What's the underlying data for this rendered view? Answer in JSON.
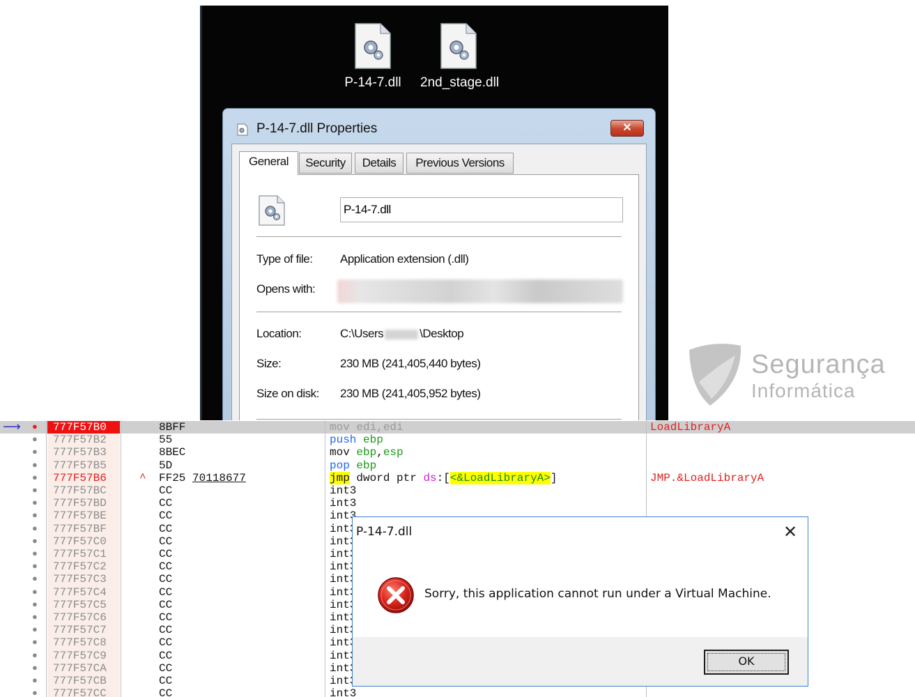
{
  "desktop": {
    "icons": [
      {
        "label": "P-14-7.dll"
      },
      {
        "label": "2nd_stage.dll"
      }
    ]
  },
  "properties": {
    "title": "P-14-7.dll Properties",
    "close_label": "✕",
    "tabs": [
      "General",
      "Security",
      "Details",
      "Previous Versions"
    ],
    "filename": "P-14-7.dll",
    "type_label": "Type of file:",
    "type_value": "Application extension (.dll)",
    "opens_label": "Opens with:",
    "location_label": "Location:",
    "location_prefix": "C:\\Users",
    "location_suffix": "\\Desktop",
    "size_label": "Size:",
    "size_value": "230 MB (241,405,440 bytes)",
    "disk_label": "Size on disk:",
    "disk_value": "230 MB (241,405,952 bytes)"
  },
  "watermark": {
    "line1": "Segurança",
    "line2": "Informática"
  },
  "debugger": {
    "rows": [
      {
        "addr": "777F57B0",
        "bytes": "8BFF",
        "dis": "mov edi,edi",
        "comment": "LoadLibraryA"
      },
      {
        "addr": "777F57B2",
        "bytes": "55",
        "dis": "push ebp",
        "comment": ""
      },
      {
        "addr": "777F57B3",
        "bytes": "8BEC",
        "dis": "mov ebp,esp",
        "comment": ""
      },
      {
        "addr": "777F57B5",
        "bytes": "5D",
        "dis": "pop ebp",
        "comment": ""
      },
      {
        "addr": "777F57B6",
        "bytes": "FF25 70118677",
        "dis": "jmp dword ptr ds:[<&LoadLibraryA>]",
        "comment": "JMP.&LoadLibraryA"
      },
      {
        "addr": "777F57BC",
        "bytes": "CC",
        "dis": "int3",
        "comment": ""
      },
      {
        "addr": "777F57BD",
        "bytes": "CC",
        "dis": "int3",
        "comment": ""
      },
      {
        "addr": "777F57BE",
        "bytes": "CC",
        "dis": "int3",
        "comment": ""
      },
      {
        "addr": "777F57BF",
        "bytes": "CC",
        "dis": "int3",
        "comment": ""
      },
      {
        "addr": "777F57C0",
        "bytes": "CC",
        "dis": "int3",
        "comment": ""
      },
      {
        "addr": "777F57C1",
        "bytes": "CC",
        "dis": "int3",
        "comment": ""
      },
      {
        "addr": "777F57C2",
        "bytes": "CC",
        "dis": "int3",
        "comment": ""
      },
      {
        "addr": "777F57C3",
        "bytes": "CC",
        "dis": "int3",
        "comment": ""
      },
      {
        "addr": "777F57C4",
        "bytes": "CC",
        "dis": "int3",
        "comment": ""
      },
      {
        "addr": "777F57C5",
        "bytes": "CC",
        "dis": "int3",
        "comment": ""
      },
      {
        "addr": "777F57C6",
        "bytes": "CC",
        "dis": "int3",
        "comment": ""
      },
      {
        "addr": "777F57C7",
        "bytes": "CC",
        "dis": "int3",
        "comment": ""
      },
      {
        "addr": "777F57C8",
        "bytes": "CC",
        "dis": "int3",
        "comment": ""
      },
      {
        "addr": "777F57C9",
        "bytes": "CC",
        "dis": "int3",
        "comment": ""
      },
      {
        "addr": "777F57CA",
        "bytes": "CC",
        "dis": "int3",
        "comment": ""
      },
      {
        "addr": "777F57CB",
        "bytes": "CC",
        "dis": "int3",
        "comment": ""
      },
      {
        "addr": "777F57CC",
        "bytes": "CC",
        "dis": "int3",
        "comment": ""
      }
    ]
  },
  "msgbox": {
    "title": "P-14-7.dll",
    "close_label": "✕",
    "message": "Sorry, this application cannot run under a Virtual Machine.",
    "ok_label": "OK",
    "icon": "error-icon"
  },
  "colors": {
    "desktop_bg": "#050505",
    "addr_highlight": "#ee1111",
    "comment": "#e02020",
    "msgbox_border": "#3d7fd1"
  }
}
